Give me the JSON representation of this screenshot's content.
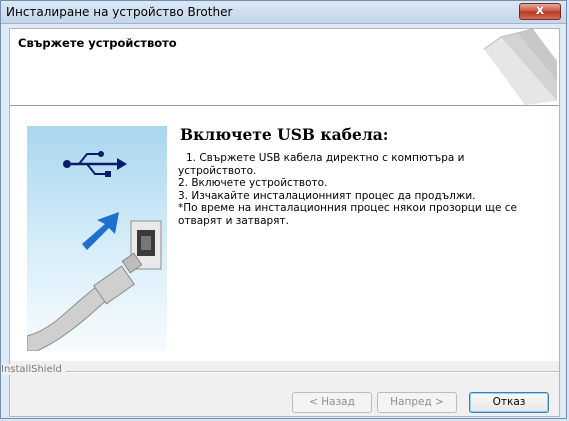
{
  "window": {
    "title": "Инсталиране на устройство Brother",
    "close_label": "x"
  },
  "header": {
    "title": "Свържете устройството"
  },
  "main": {
    "heading": "Включете USB кабела:",
    "instructions": [
      "1. Свържете USB кабела директно с компютъра и",
      "устройството.",
      "2. Включете устройството.",
      "3. Изчакайте инсталационният процес да продължи.",
      " *По време на инсталационния процес някои прозорци ще се",
      "отварят и затварят."
    ]
  },
  "footer": {
    "brand": "InstallShield",
    "back_label": "< Назад",
    "next_label": "Напред >",
    "cancel_label": "Отказ"
  },
  "colors": {
    "accent": "#1f6fd1",
    "close_button": "#c7523f"
  }
}
